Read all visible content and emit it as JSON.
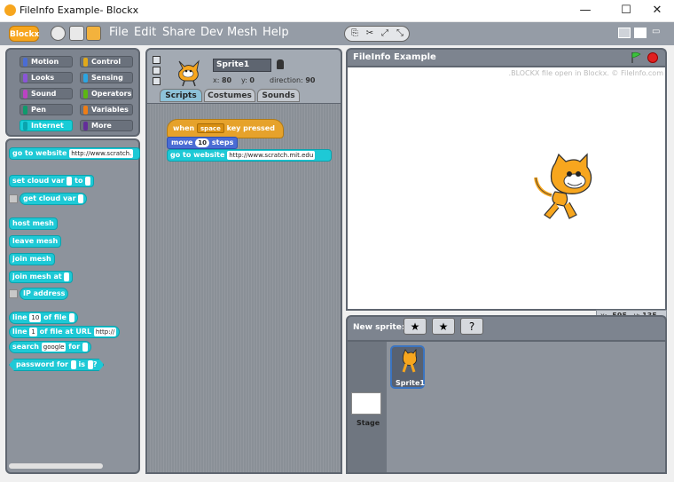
{
  "window": {
    "title": "FileInfo Example- Blockx",
    "minimize": "—",
    "maximize": "☐",
    "close": "✕"
  },
  "menubar": {
    "logo": "Blockx",
    "items": [
      "File",
      "Edit",
      "Share",
      "Dev",
      "Mesh",
      "Help"
    ]
  },
  "categories": [
    {
      "label": "Motion",
      "color": "#4a6cd4"
    },
    {
      "label": "Control",
      "color": "#e1a91a"
    },
    {
      "label": "Looks",
      "color": "#8a55d7"
    },
    {
      "label": "Sensing",
      "color": "#2ca5e2"
    },
    {
      "label": "Sound",
      "color": "#bb42c3"
    },
    {
      "label": "Operators",
      "color": "#5cb712"
    },
    {
      "label": "Pen",
      "color": "#0e9a6c"
    },
    {
      "label": "Variables",
      "color": "#ee7d16"
    },
    {
      "label": "Internet",
      "color": "#19ccd7"
    },
    {
      "label": "More",
      "color": "#632d99"
    }
  ],
  "palette": {
    "go_to_website": "go to website",
    "url_value": "http://www.scratch.",
    "set_cloud_var": "set cloud var",
    "to": "to",
    "get_cloud_var": "get cloud var",
    "host_mesh": "host mesh",
    "leave_mesh": "leave mesh",
    "join_mesh": "join mesh",
    "join_mesh_at": "join mesh at",
    "ip_address": "IP address",
    "line": "line",
    "line_num": "10",
    "of_file": "of file",
    "line_num2": "1",
    "of_file_at_url": "of file at URL",
    "url_short": "http://",
    "search": "search",
    "search_engine": "google",
    "for": "for",
    "password_for": "password for",
    "is": "is",
    "q": "?"
  },
  "sprite": {
    "name": "Sprite1",
    "x_label": "x:",
    "x": "80",
    "y_label": "y:",
    "y": "0",
    "dir_label": "direction:",
    "direction": "90"
  },
  "tabs": [
    "Scripts",
    "Costumes",
    "Sounds"
  ],
  "script": {
    "when": "when",
    "key": "space",
    "key_pressed": "key pressed",
    "move": "move",
    "steps_value": "10",
    "steps": "steps",
    "go_to_website": "go to website",
    "url": "http://www.scratch.mit.edu"
  },
  "stage": {
    "title": "FileInfo Example",
    "info": ".BLOCKX file open in Blockx. © FileInfo.com",
    "mouse_x_label": "x:",
    "mouse_x": "-595",
    "mouse_y_label": "y:",
    "mouse_y": "135"
  },
  "new_sprite_label": "New sprite:",
  "sprites": [
    {
      "name": "Sprite1"
    }
  ],
  "stage_thumb_label": "Stage"
}
